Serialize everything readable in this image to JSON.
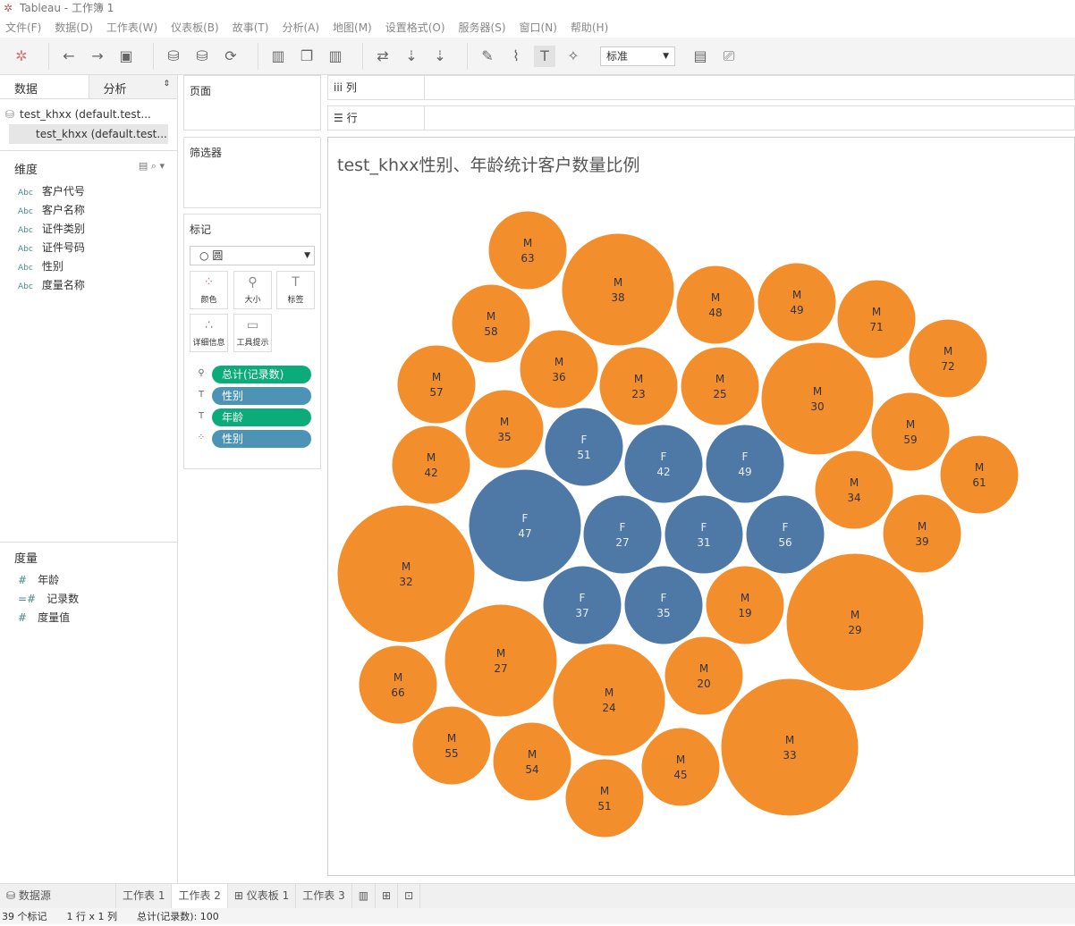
{
  "window": {
    "title": "Tableau - 工作簿 1"
  },
  "menu": [
    "文件(F)",
    "数据(D)",
    "工作表(W)",
    "仪表板(B)",
    "故事(T)",
    "分析(A)",
    "地图(M)",
    "设置格式(O)",
    "服务器(S)",
    "窗口(N)",
    "帮助(H)"
  ],
  "toolbar": {
    "fit_select": "标准"
  },
  "left": {
    "tab_data": "数据",
    "tab_analysis": "分析",
    "sources": [
      "test_khxx (default.test...",
      "test_khxx (default.test..."
    ],
    "dimensions_label": "维度",
    "dimensions": [
      {
        "type": "Abc",
        "name": "客户代号"
      },
      {
        "type": "Abc",
        "name": "客户名称"
      },
      {
        "type": "Abc",
        "name": "证件类别"
      },
      {
        "type": "Abc",
        "name": "证件号码"
      },
      {
        "type": "Abc",
        "name": "性别"
      },
      {
        "type": "Abc",
        "name": "度量名称"
      }
    ],
    "measures_label": "度量",
    "measures": [
      {
        "type": "#",
        "name": "年龄"
      },
      {
        "type": "=#",
        "name": "记录数"
      },
      {
        "type": "#",
        "name": "度量值"
      }
    ]
  },
  "cards": {
    "pages": "页面",
    "filters": "筛选器",
    "marks": "标记",
    "mark_type": "圆",
    "buttons": {
      "color": "颜色",
      "size": "大小",
      "label": "标签",
      "detail": "详细信息",
      "tooltip": "工具提示"
    },
    "pills": [
      {
        "icon": "size",
        "text": "总计(记录数)",
        "color": "#0bab7a"
      },
      {
        "icon": "label",
        "text": "性别",
        "color": "#4c93b5"
      },
      {
        "icon": "label",
        "text": "年龄",
        "color": "#0bab7a"
      },
      {
        "icon": "color",
        "text": "性别",
        "color": "#4c93b5"
      }
    ]
  },
  "shelves": {
    "columns": "列",
    "rows": "行"
  },
  "bottom_tabs": {
    "datasource": "数据源",
    "sheets": [
      "工作表 1",
      "工作表 2",
      "仪表板 1",
      "工作表 3"
    ]
  },
  "status": {
    "marks": "39 个标记",
    "dims": "1 行 x 1 列",
    "sum": "总计(记录数): 100"
  },
  "chart_data": {
    "type": "packed-bubble",
    "title": "test_khxx性别、年龄统计客户数量比例",
    "colors": {
      "M": "#f28e2b",
      "F": "#4e79a7"
    },
    "bubbles": [
      {
        "g": "M",
        "age": "63"
      },
      {
        "g": "M",
        "age": "38"
      },
      {
        "g": "M",
        "age": "48"
      },
      {
        "g": "M",
        "age": "49"
      },
      {
        "g": "M",
        "age": "71"
      },
      {
        "g": "M",
        "age": "72"
      },
      {
        "g": "M",
        "age": "58"
      },
      {
        "g": "M",
        "age": "36"
      },
      {
        "g": "M",
        "age": "23"
      },
      {
        "g": "M",
        "age": "25"
      },
      {
        "g": "M",
        "age": "30"
      },
      {
        "g": "M",
        "age": "57"
      },
      {
        "g": "M",
        "age": "35"
      },
      {
        "g": "F",
        "age": "51"
      },
      {
        "g": "F",
        "age": "42"
      },
      {
        "g": "F",
        "age": "49"
      },
      {
        "g": "M",
        "age": "59"
      },
      {
        "g": "M",
        "age": "61"
      },
      {
        "g": "M",
        "age": "42"
      },
      {
        "g": "M",
        "age": "34"
      },
      {
        "g": "F",
        "age": "47"
      },
      {
        "g": "F",
        "age": "27"
      },
      {
        "g": "F",
        "age": "31"
      },
      {
        "g": "F",
        "age": "56"
      },
      {
        "g": "M",
        "age": "39"
      },
      {
        "g": "M",
        "age": "32"
      },
      {
        "g": "F",
        "age": "37"
      },
      {
        "g": "F",
        "age": "35"
      },
      {
        "g": "M",
        "age": "19"
      },
      {
        "g": "M",
        "age": "29"
      },
      {
        "g": "M",
        "age": "27"
      },
      {
        "g": "M",
        "age": "66"
      },
      {
        "g": "M",
        "age": "20"
      },
      {
        "g": "M",
        "age": "24"
      },
      {
        "g": "M",
        "age": "55"
      },
      {
        "g": "M",
        "age": "54"
      },
      {
        "g": "M",
        "age": "45"
      },
      {
        "g": "M",
        "age": "33"
      },
      {
        "g": "M",
        "age": "51"
      }
    ]
  }
}
